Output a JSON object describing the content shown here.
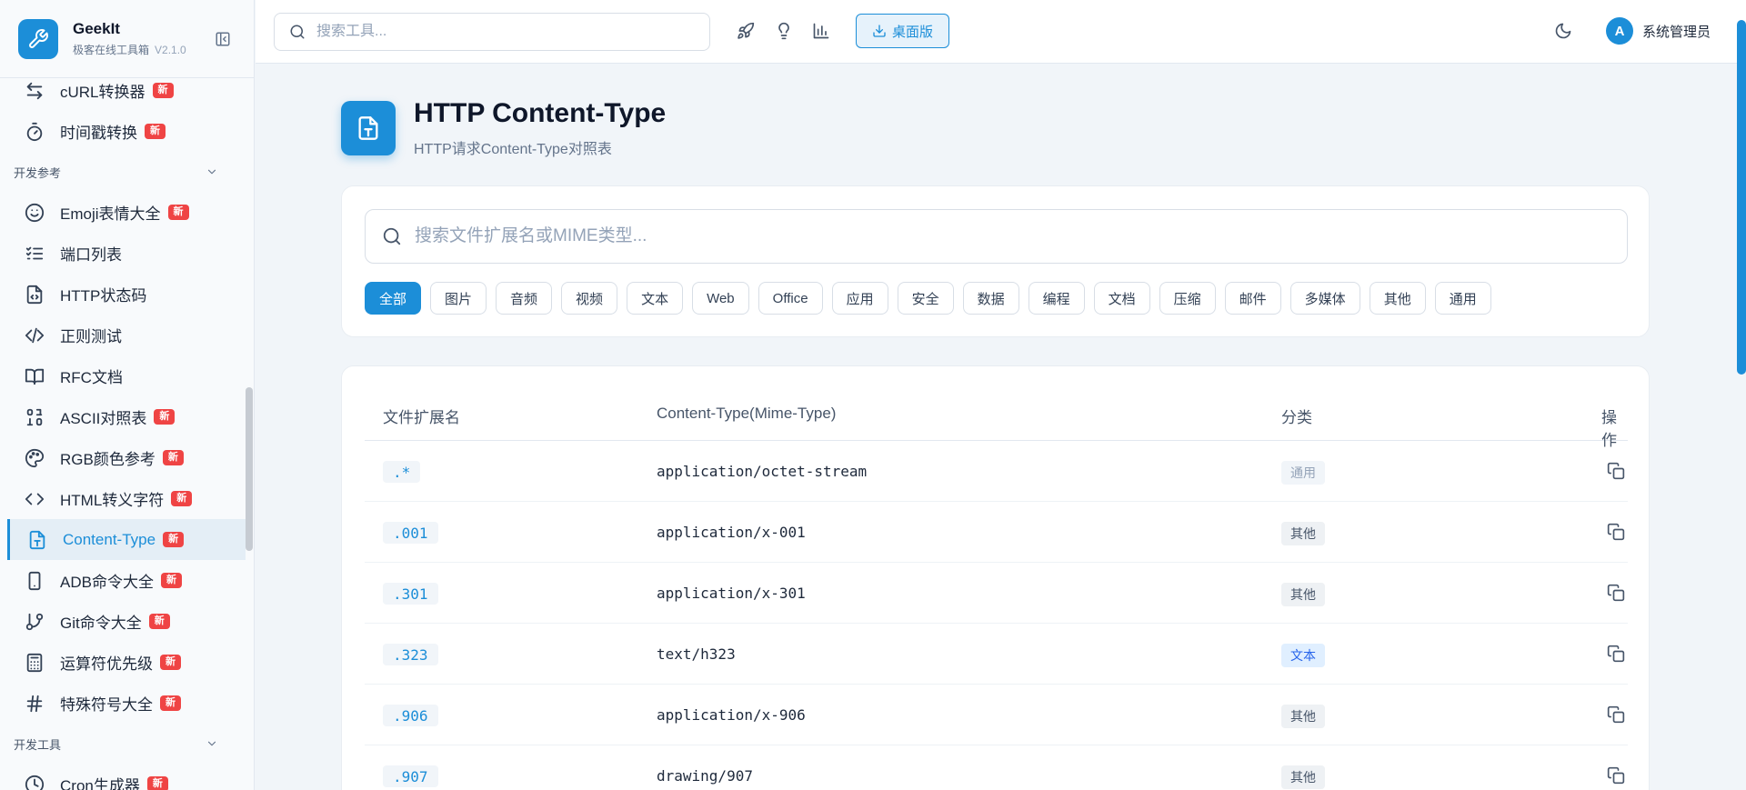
{
  "app": {
    "name": "GeekIt",
    "subtitle": "极客在线工具箱",
    "version": "V2.1.0"
  },
  "sidebar": {
    "badge_label": "新",
    "items_top": [
      {
        "label": "cURL转换器",
        "icon": "arrows-left-right-icon",
        "is_new": true
      },
      {
        "label": "时间戳转换",
        "icon": "timer-icon",
        "is_new": true
      }
    ],
    "group_dev_ref": "开发参考",
    "items_ref": [
      {
        "label": "Emoji表情大全",
        "icon": "smile-icon",
        "is_new": true
      },
      {
        "label": "端口列表",
        "icon": "list-checks-icon",
        "is_new": false
      },
      {
        "label": "HTTP状态码",
        "icon": "file-code-icon",
        "is_new": false
      },
      {
        "label": "正则测试",
        "icon": "code-icon",
        "is_new": false
      },
      {
        "label": "RFC文档",
        "icon": "book-open-icon",
        "is_new": false
      },
      {
        "label": "ASCII对照表",
        "icon": "ascii-icon",
        "is_new": true
      },
      {
        "label": "RGB颜色参考",
        "icon": "palette-icon",
        "is_new": true
      },
      {
        "label": "HTML转义字符",
        "icon": "angle-brackets-icon",
        "is_new": true
      },
      {
        "label": "Content-Type",
        "icon": "file-type-icon",
        "is_new": true,
        "active": true
      },
      {
        "label": "ADB命令大全",
        "icon": "smartphone-icon",
        "is_new": true
      },
      {
        "label": "Git命令大全",
        "icon": "git-branch-icon",
        "is_new": true
      },
      {
        "label": "运算符优先级",
        "icon": "calculator-icon",
        "is_new": true
      },
      {
        "label": "特殊符号大全",
        "icon": "hash-icon",
        "is_new": true
      }
    ],
    "group_dev_tools": "开发工具",
    "items_tools": [
      {
        "label": "Cron生成器",
        "icon": "clock-icon",
        "is_new": true
      }
    ]
  },
  "header": {
    "search_placeholder": "搜索工具...",
    "desktop_button": "桌面版",
    "user_initial": "A",
    "user_name": "系统管理员"
  },
  "page": {
    "title": "HTTP Content-Type",
    "subtitle": "HTTP请求Content-Type对照表",
    "filter_placeholder": "搜索文件扩展名或MIME类型...",
    "categories": [
      "全部",
      "图片",
      "音频",
      "视频",
      "文本",
      "Web",
      "Office",
      "应用",
      "安全",
      "数据",
      "编程",
      "文档",
      "压缩",
      "邮件",
      "多媒体",
      "其他",
      "通用"
    ],
    "active_category": "全部"
  },
  "table": {
    "columns": {
      "ext": "文件扩展名",
      "mime": "Content-Type(Mime-Type)",
      "category": "分类",
      "action": "操作"
    },
    "rows": [
      {
        "ext": ".*",
        "mime": "application/octet-stream",
        "category": "通用",
        "kind": "general"
      },
      {
        "ext": ".001",
        "mime": "application/x-001",
        "category": "其他",
        "kind": "other"
      },
      {
        "ext": ".301",
        "mime": "application/x-301",
        "category": "其他",
        "kind": "other"
      },
      {
        "ext": ".323",
        "mime": "text/h323",
        "category": "文本",
        "kind": "text"
      },
      {
        "ext": ".906",
        "mime": "application/x-906",
        "category": "其他",
        "kind": "other"
      },
      {
        "ext": ".907",
        "mime": "drawing/907",
        "category": "其他",
        "kind": "other"
      }
    ]
  },
  "colors": {
    "accent": "#1c8ed8",
    "badge": "#ef4444",
    "text_tag": "#2563eb"
  }
}
